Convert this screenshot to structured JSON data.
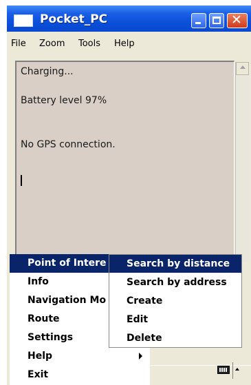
{
  "window": {
    "title": "Pocket_PC",
    "min_icon": "minimize-icon",
    "max_icon": "maximize-icon",
    "close_icon": "close-icon",
    "close_glyph": "✕"
  },
  "menubar": [
    "File",
    "Zoom",
    "Tools",
    "Help"
  ],
  "content": {
    "lines": [
      "Charging...",
      "Battery level 97%",
      "No GPS connection."
    ]
  },
  "start_menu": {
    "items": [
      {
        "label": "Point of Intere",
        "underline": "P",
        "active": true
      },
      {
        "label": "Info",
        "underline": "I"
      },
      {
        "label": "Navigation Mo",
        "underline": "N"
      },
      {
        "label": "Route",
        "underline": "R"
      },
      {
        "label": "Settings",
        "underline": "S"
      },
      {
        "label": "Help",
        "underline": "H",
        "has_submenu": true
      },
      {
        "label": "Exit",
        "underline": "E"
      }
    ]
  },
  "submenu": {
    "items": [
      {
        "label": "Search by distance",
        "active": true
      },
      {
        "label": "Search by address"
      },
      {
        "label": "Create"
      },
      {
        "label": "Edit"
      },
      {
        "label": "Delete"
      }
    ]
  },
  "icons": {
    "keyboard": "keyboard-icon",
    "sip_arrow": "up-arrow-icon",
    "app": "app-icon"
  },
  "colors": {
    "titlebar": "#0a4ed8",
    "highlight": "#0a246a",
    "content_bg": "#d9cfc7"
  }
}
